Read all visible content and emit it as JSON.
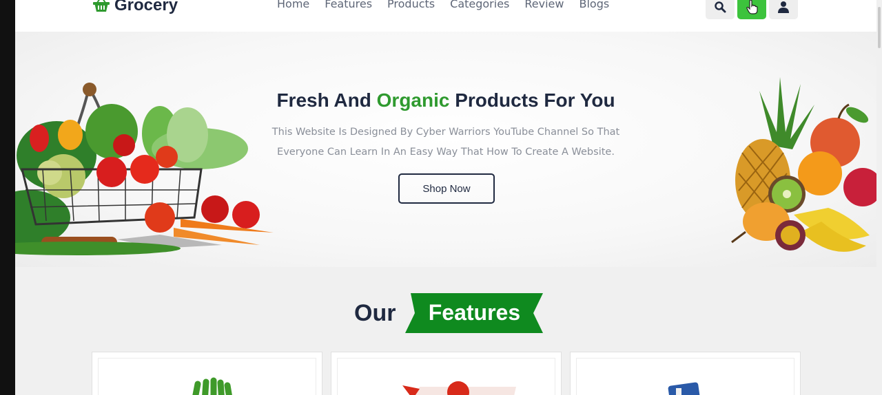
{
  "brand": {
    "name": "Grocery"
  },
  "nav": {
    "items": [
      "Home",
      "Features",
      "Products",
      "Categories",
      "Review",
      "Blogs"
    ]
  },
  "header_icons": [
    "search-icon",
    "cart-icon",
    "user-icon"
  ],
  "hero": {
    "title_prefix": "Fresh And ",
    "title_highlight": "Organic",
    "title_suffix": " Products For You",
    "description": "This Website Is Designed By Cyber Warriors YouTube Channel So That Everyone Can Learn In An Easy Way That How To Create A Website.",
    "button_label": "Shop Now"
  },
  "features": {
    "title_prefix": "Our",
    "title_highlight": "Features"
  },
  "colors": {
    "accent": "#2f9a2f",
    "dark": "#1f2940",
    "ribbon": "#0f8a1f",
    "active_button": "#3cc33c"
  }
}
